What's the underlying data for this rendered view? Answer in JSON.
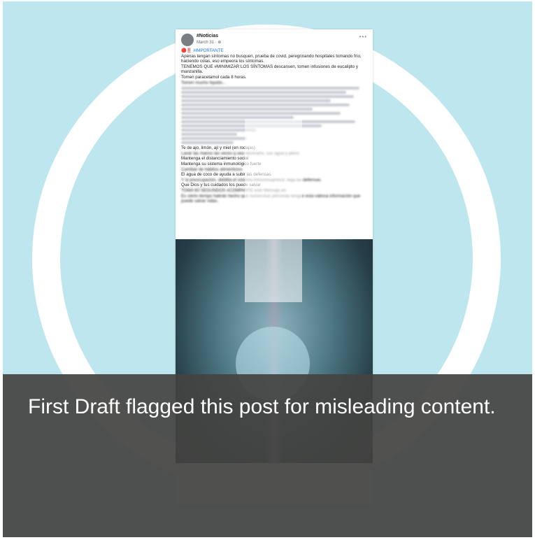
{
  "post": {
    "author": "#Noticias",
    "date": "March 31 · ⊕",
    "more_icon": "•••",
    "lines": [
      {
        "text": "🔴‼️ #IMPORTANTE",
        "tagged": true
      },
      {
        "text": "Apenas tengan síntomas no busquen, prueba de covid, peregrinando hospitales tomando frío, haciendo colas, eso empeora los síntomas."
      },
      {
        "text": "TENEMOS QUE #MINIMIZAR LOS SÍNTOMAS descansen, tomen infusiones de eucalipto y manzanilla."
      },
      {
        "text": "Tomen paracetamol cada 8 horas."
      },
      {
        "text": "Tomen mucho líquido..."
      }
    ],
    "lines_mid": [
      {
        "text": "Te de ajo, limón, ají y miel (en rodajas)"
      },
      {
        "text": "Lavar las manos las veces q sea necesario, con agua y jabón"
      },
      {
        "text": "Mantenga el distanciamiento social"
      },
      {
        "text": "Mantenga su sistema inmunológico fuerte"
      },
      {
        "text": "Cambiar de hábitos alimenticios"
      },
      {
        "text": "El agua de coco de ayuda a subir las defensas."
      },
      {
        "text": "Y la preocupación, debilita el sistema inmunosupresor, baja las defensas."
      },
      {
        "text": "Que Dios y tus cuidados los puede salvar"
      },
      {
        "text": "TÓMA 60 SEGUNDOS #COMPARTE este Mensaje en"
      },
      {
        "text": "Es cierto tiempo habrán hecho que numerosas personas tengan esta valiosa información que puede salvar vidas."
      }
    ]
  },
  "banner": {
    "text": "First Draft flagged this post for misleading content."
  }
}
